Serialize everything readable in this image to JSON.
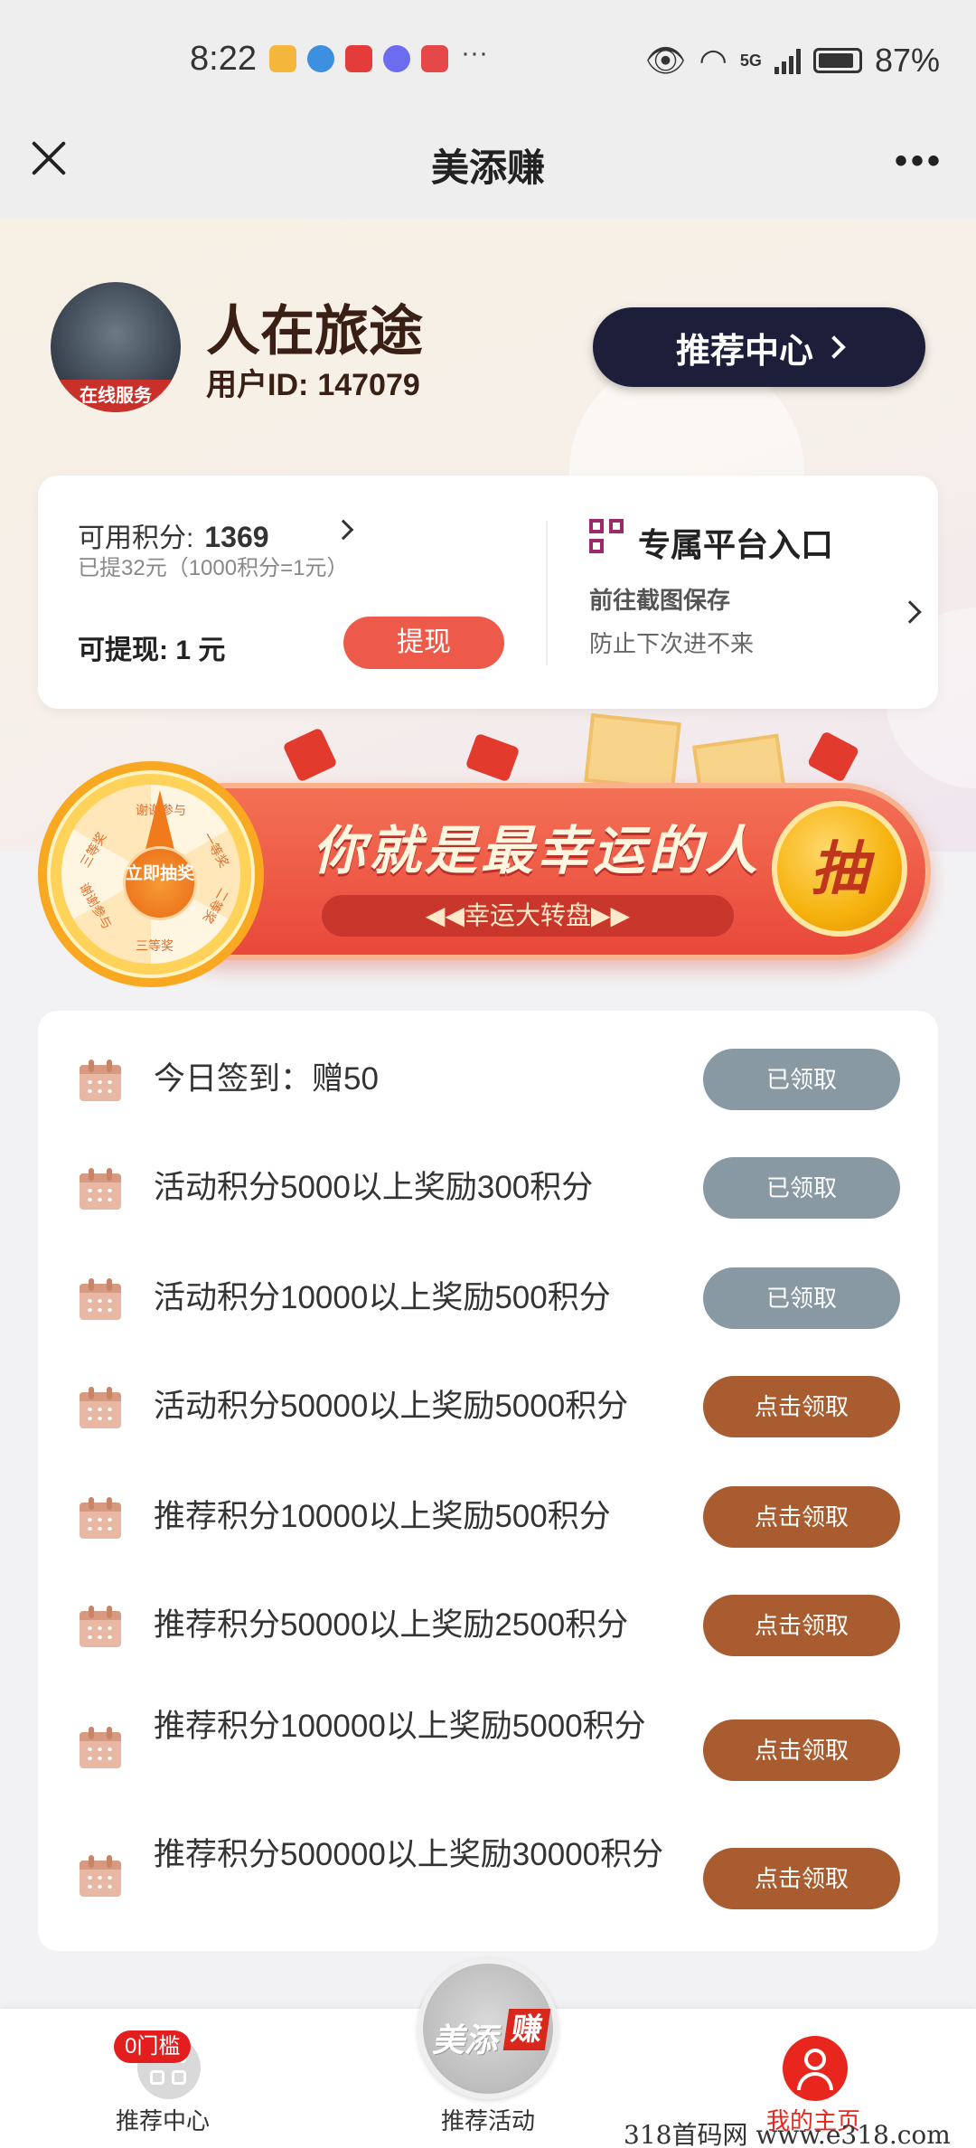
{
  "status_bar": {
    "time": "8:22",
    "more": "···",
    "network": "5G",
    "battery": "87%"
  },
  "title_bar": {
    "title": "美添赚",
    "more": "•••"
  },
  "profile": {
    "name": "人在旅途",
    "user_id_label": "用户ID:",
    "user_id": "147079",
    "avatar_caption": "在线服务",
    "recommend_button": "推荐中心"
  },
  "points": {
    "available_label": "可用积分:",
    "available_value": "1369",
    "withdrawn_note": "已提32元（1000积分=1元）",
    "withdrawable": "可提现: 1 元",
    "withdraw_button": "提现",
    "platform_title": "专属平台入口",
    "platform_line1": "前往截图保存",
    "platform_line2": "防止下次进不来"
  },
  "lucky_banner": {
    "title": "你就是最幸运的人",
    "subtitle": "◀◀幸运大转盘▶▶",
    "draw_label": "抽",
    "wheel_center": "立即抽奖",
    "wheel_segments": [
      "谢谢参与",
      "一等奖",
      "二等奖",
      "三等奖",
      "谢谢参与",
      "三等奖"
    ]
  },
  "tasks": [
    {
      "text": "今日签到：赠50",
      "button": "已领取",
      "status": "claimed"
    },
    {
      "text": "活动积分5000以上奖励300积分",
      "button": "已领取",
      "status": "claimed"
    },
    {
      "text": "活动积分10000以上奖励500积分",
      "button": "已领取",
      "status": "claimed"
    },
    {
      "text": "活动积分50000以上奖励5000积分",
      "button": "点击领取",
      "status": "claim"
    },
    {
      "text": "推荐积分10000以上奖励500积分",
      "button": "点击领取",
      "status": "claim"
    },
    {
      "text": "推荐积分50000以上奖励2500积分",
      "button": "点击领取",
      "status": "claim"
    },
    {
      "text": "推荐积分100000以上奖励5000积分",
      "button": "点击领取",
      "status": "claim"
    },
    {
      "text": "推荐积分500000以上奖励30000积分",
      "button": "点击领取",
      "status": "claim"
    }
  ],
  "bottom_nav": {
    "badge": "0门槛",
    "left": "推荐中心",
    "center": "推荐活动",
    "center_logo_text": "美添",
    "center_logo_mark": "赚",
    "right": "我的主页"
  },
  "watermark": "318首码网 www.e318.com",
  "colors": {
    "claimed_button": "#8899a3",
    "claim_button": "#a85c30",
    "withdraw_button": "#ee5a4a",
    "recommend_button": "#1d1f3a",
    "active_nav": "#e8261e"
  }
}
